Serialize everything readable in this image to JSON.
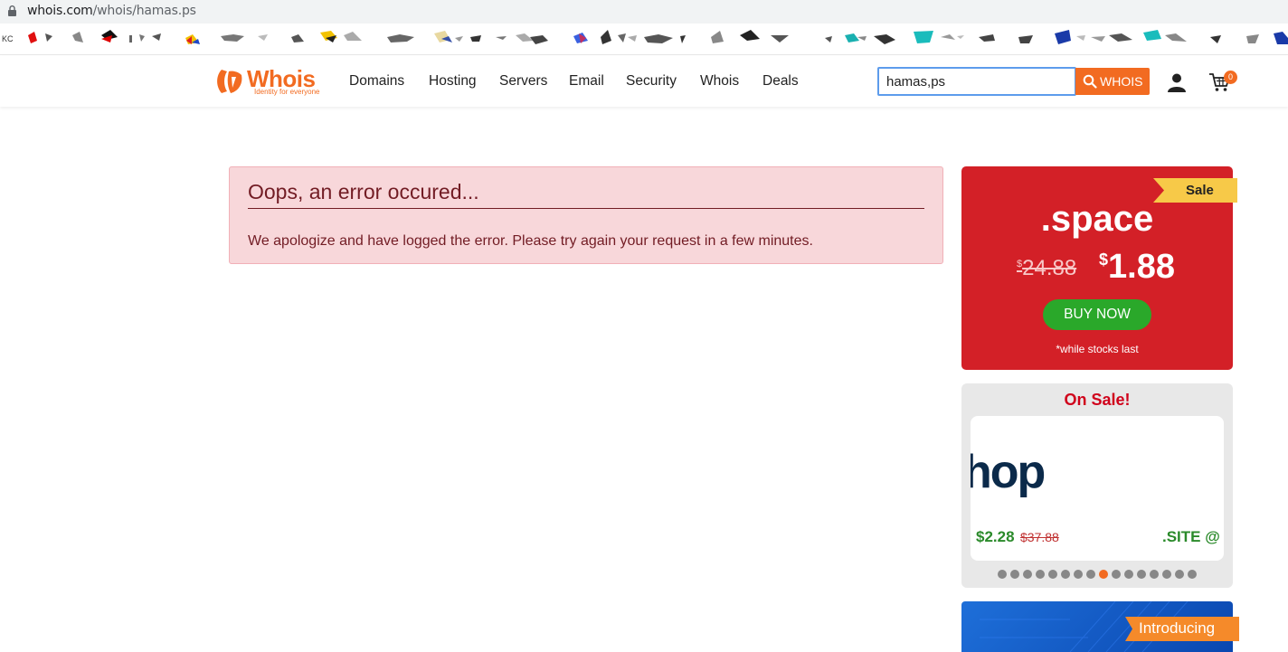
{
  "browser": {
    "url_host": "whois.com",
    "url_path": "/whois/hamas.ps",
    "bookmarks_first_text": "KC"
  },
  "header": {
    "logo_word": "Whois",
    "logo_tagline": "Identity for everyone",
    "nav": [
      "Domains",
      "Hosting",
      "Servers",
      "Email",
      "Security",
      "Whois",
      "Deals"
    ],
    "search_value": "hamas,ps",
    "search_button": "WHOIS",
    "cart_count": "0"
  },
  "error": {
    "title": "Oops, an error occured...",
    "message": "We apologize and have logged the error. Please try again your request in a few minutes."
  },
  "promo": {
    "ribbon": "Sale",
    "tld": ".space",
    "old_currency": "$",
    "old_price": "24.88",
    "new_currency": "$",
    "new_price": "1.88",
    "button": "BUY NOW",
    "note": "*while stocks last"
  },
  "on_sale": {
    "title": "On Sale!",
    "brand_fragment": "hop",
    "price": "$2.28",
    "old_price": "$37.88",
    "next_label": ".SITE @ $",
    "dot_count": 16,
    "active_dot": 8
  },
  "introducing": {
    "label": "Introducing"
  },
  "colors": {
    "brand_orange": "#f26b21",
    "promo_red": "#d32027",
    "buy_green": "#2aa82a",
    "error_bg": "#f8d7da",
    "error_text": "#721c24"
  }
}
